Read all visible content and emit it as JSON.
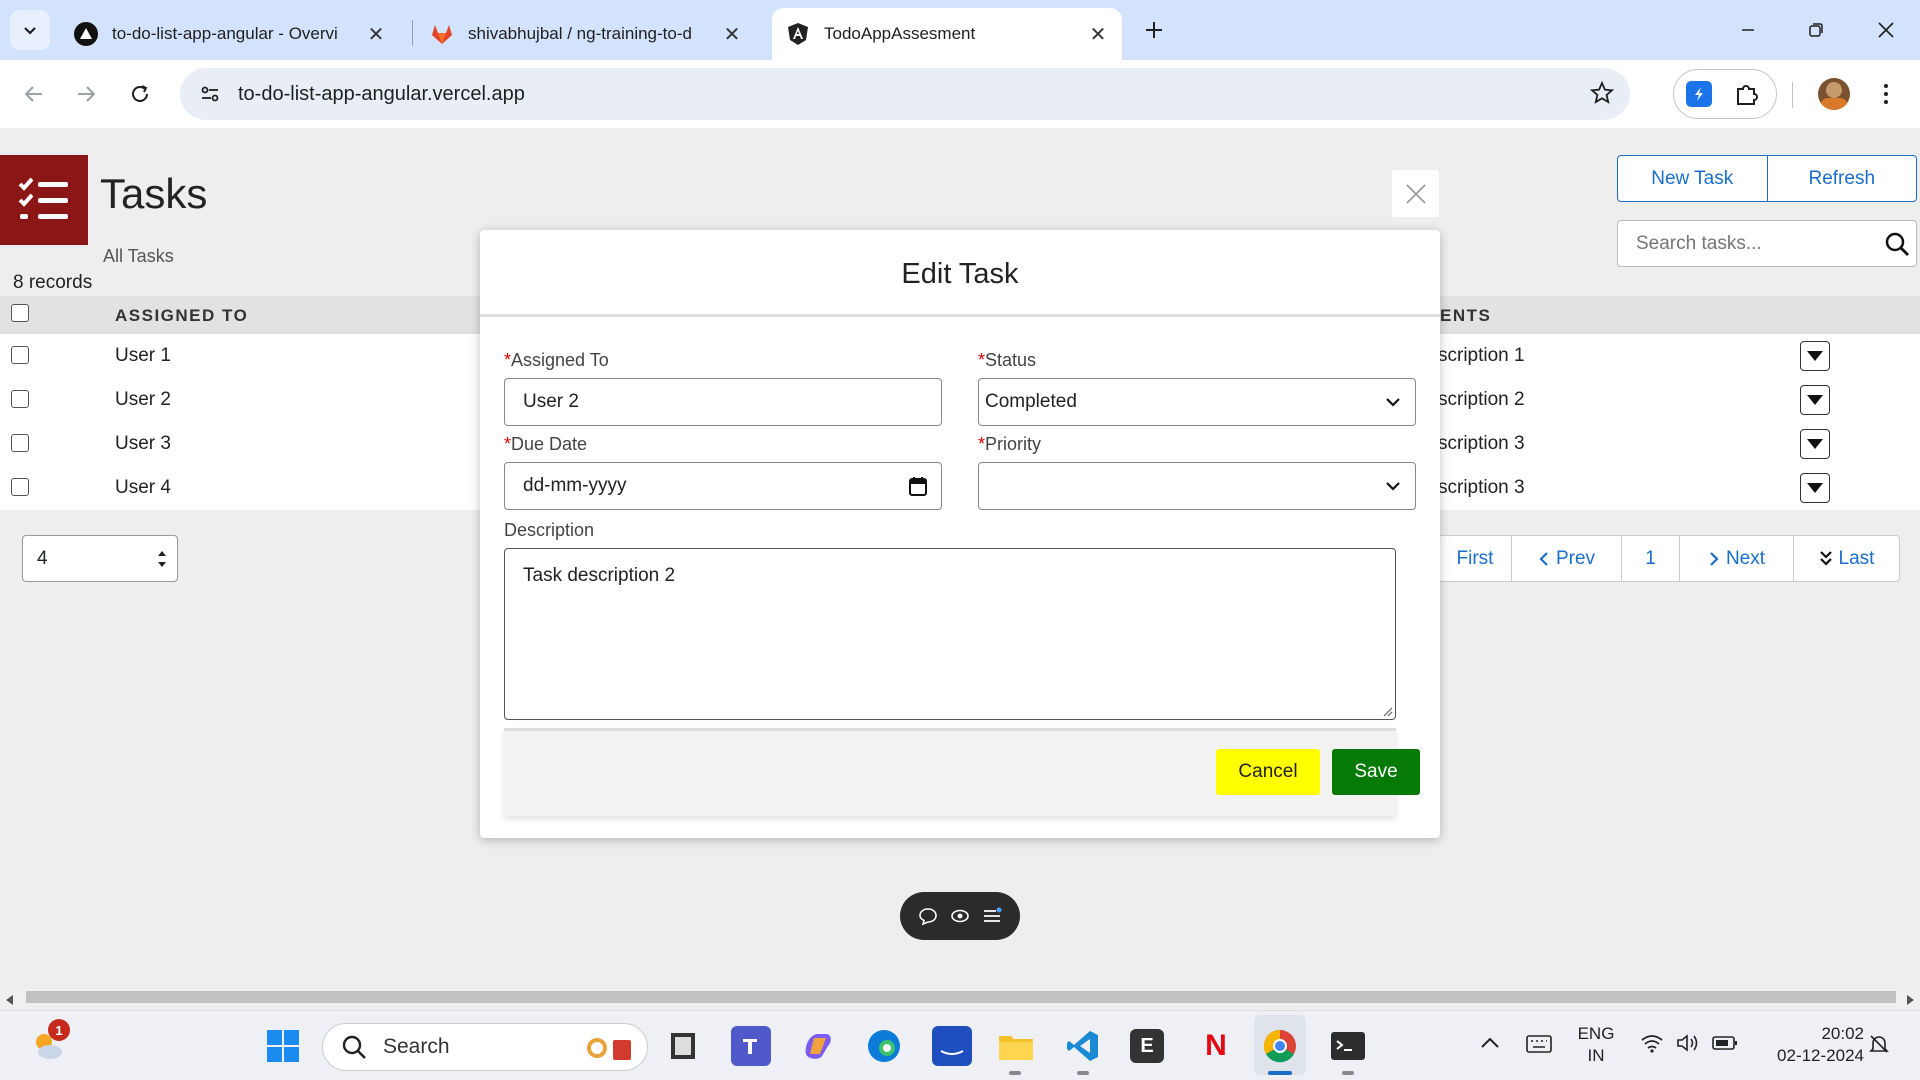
{
  "browser": {
    "tabs": [
      {
        "title": "to-do-list-app-angular - Overvi",
        "favicon": "vercel-icon"
      },
      {
        "title": "shivabhujbal / ng-training-to-d",
        "favicon": "gitlab-icon"
      },
      {
        "title": "TodoAppAssesment",
        "favicon": "angular-icon",
        "active": true
      }
    ],
    "url": "to-do-list-app-angular.vercel.app"
  },
  "page": {
    "title": "Tasks",
    "subtitle": "All Tasks",
    "record_count": "8 records",
    "new_task_label": "New Task",
    "refresh_label": "Refresh",
    "search_placeholder": "Search tasks...",
    "columns": {
      "assigned_to": "ASSIGNED TO",
      "comments_partial": "ENTS"
    },
    "rows": [
      {
        "assigned_to": "User 1",
        "comment": "scription 1"
      },
      {
        "assigned_to": "User 2",
        "comment": "scription 2"
      },
      {
        "assigned_to": "User 3",
        "comment": "scription 3"
      },
      {
        "assigned_to": "User 4",
        "comment": "scription 3"
      }
    ],
    "page_size": "4",
    "pager": {
      "first": "First",
      "prev": "Prev",
      "page": "1",
      "next": "Next",
      "last": "Last"
    }
  },
  "modal": {
    "title": "Edit Task",
    "assigned_to_label": "Assigned To",
    "assigned_to_value": "User 2",
    "status_label": "Status",
    "status_value": "Completed",
    "due_date_label": "Due Date",
    "due_date_placeholder": "dd-mm-yyyy",
    "priority_label": "Priority",
    "priority_value": "",
    "description_label": "Description",
    "description_value": "Task description 2",
    "required_mark": "*",
    "cancel_label": "Cancel",
    "save_label": "Save"
  },
  "taskbar": {
    "search_label": "Search",
    "notification_count": "1",
    "lang_line1": "ENG",
    "lang_line2": "IN",
    "time": "20:02",
    "date": "02-12-2024",
    "e_app_letter": "E",
    "netflix_letter": "N"
  },
  "colors": {
    "accent": "#1a6ec9",
    "logo_bg": "#8b1616",
    "cancel_bg": "#ffff00",
    "save_bg": "#067a06"
  }
}
